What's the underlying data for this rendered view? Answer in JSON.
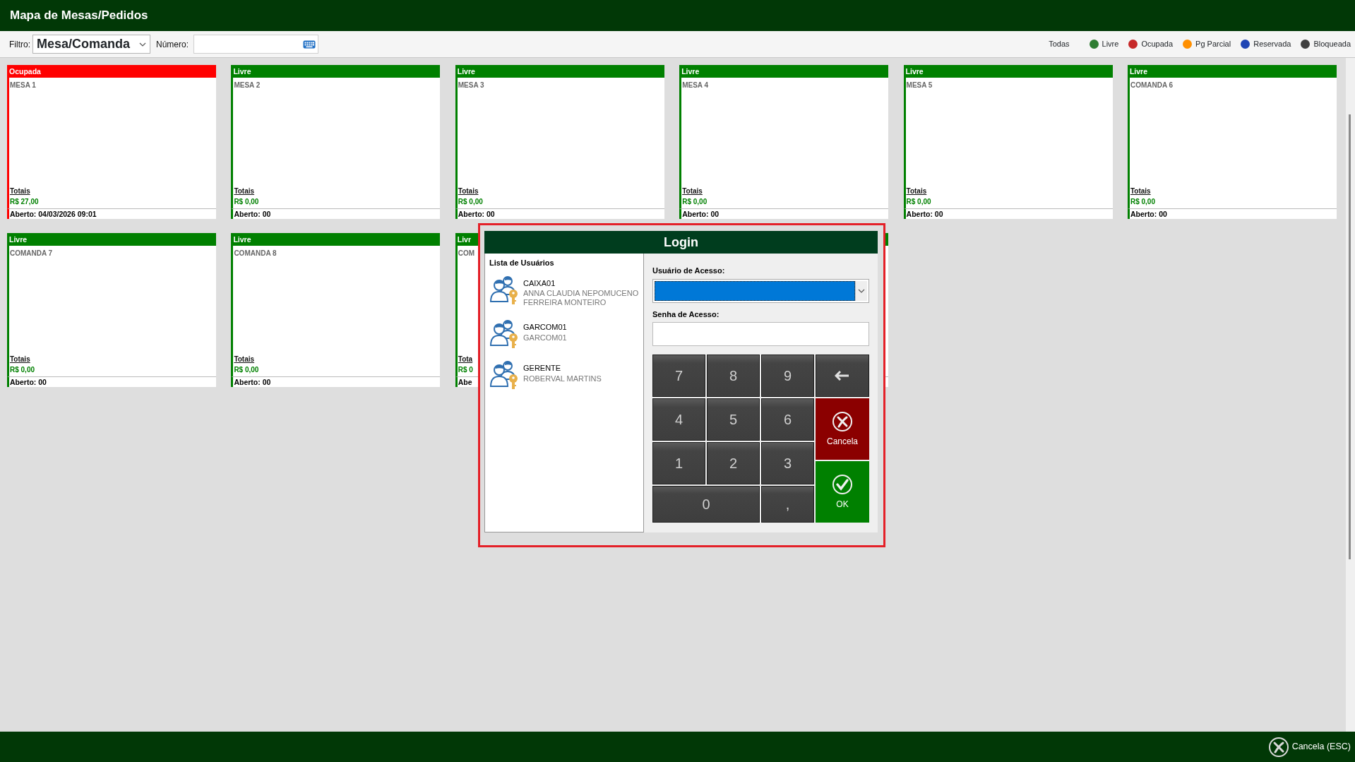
{
  "window": {
    "title": "Mapa de Mesas/Pedidos"
  },
  "toolbar": {
    "filter_label": "Filtro:",
    "filter_value": "Mesa/Comanda",
    "number_label": "Número:"
  },
  "legend": [
    {
      "label": "Todas"
    },
    {
      "label": "Livre",
      "color": "#2e7d32"
    },
    {
      "label": "Ocupada",
      "color": "#c62828"
    },
    {
      "label": "Pg Parcial",
      "color": "#ff8f00"
    },
    {
      "label": "Reservada",
      "color": "#1e44b4"
    },
    {
      "label": "Bloqueada",
      "color": "#404040"
    }
  ],
  "cards": [
    {
      "status": "Ocupada",
      "color": "#ff0000",
      "name": "MESA 1",
      "totals_label": "Totais",
      "total": "R$ 27,00",
      "opened": "Aberto: 04/03/2026 09:01"
    },
    {
      "status": "Livre",
      "color": "#008000",
      "name": "MESA 2",
      "totals_label": "Totais",
      "total": "R$ 0,00",
      "opened": "Aberto: 00"
    },
    {
      "status": "Livre",
      "color": "#008000",
      "name": "MESA 3",
      "totals_label": "Totais",
      "total": "R$ 0,00",
      "opened": "Aberto: 00"
    },
    {
      "status": "Livre",
      "color": "#008000",
      "name": "MESA 4",
      "totals_label": "Totais",
      "total": "R$ 0,00",
      "opened": "Aberto: 00"
    },
    {
      "status": "Livre",
      "color": "#008000",
      "name": "MESA 5",
      "totals_label": "Totais",
      "total": "R$ 0,00",
      "opened": "Aberto: 00"
    },
    {
      "status": "Livre",
      "color": "#008000",
      "name": "COMANDA 6",
      "totals_label": "Totais",
      "total": "R$ 0,00",
      "opened": "Aberto: 00"
    },
    {
      "status": "Livre",
      "color": "#008000",
      "name": "COMANDA 7",
      "totals_label": "Totais",
      "total": "R$ 0,00",
      "opened": "Aberto: 00"
    },
    {
      "status": "Livre",
      "color": "#008000",
      "name": "COMANDA 8",
      "totals_label": "Totais",
      "total": "R$ 0,00",
      "opened": "Aberto: 00"
    },
    {
      "status": "Livr",
      "color": "#008000",
      "name": "COM",
      "totals_label": "Tota",
      "total": "R$ 0",
      "opened": "Abe"
    },
    {
      "color": "#008000"
    }
  ],
  "login": {
    "title": "Login",
    "users_heading": "Lista de Usuários",
    "users": [
      {
        "login": "CAIXA01",
        "name": "ANNA CLAUDIA NEPOMUCENO FERREIRA MONTEIRO"
      },
      {
        "login": "GARCOM01",
        "name": "GARCOM01"
      },
      {
        "login": "GERENTE",
        "name": "ROBERVAL MARTINS"
      }
    ],
    "user_label": "Usuário de Acesso:",
    "password_label": "Senha de Acesso:",
    "keys": [
      {
        "kind": "digit",
        "label": "7"
      },
      {
        "kind": "digit",
        "label": "8"
      },
      {
        "kind": "digit",
        "label": "9"
      },
      {
        "kind": "backspace"
      },
      {
        "kind": "digit",
        "label": "4"
      },
      {
        "kind": "digit",
        "label": "5"
      },
      {
        "kind": "digit",
        "label": "6"
      },
      {
        "kind": "cancel",
        "label": "Cancela"
      },
      {
        "kind": "digit",
        "label": "1"
      },
      {
        "kind": "digit",
        "label": "2"
      },
      {
        "kind": "digit",
        "label": "3"
      },
      {
        "kind": "wide",
        "label": "0"
      },
      {
        "kind": "digit",
        "label": ","
      },
      {
        "kind": "ok",
        "label": "OK"
      }
    ]
  },
  "footer": {
    "cancel_label": "Cancela (ESC)"
  }
}
